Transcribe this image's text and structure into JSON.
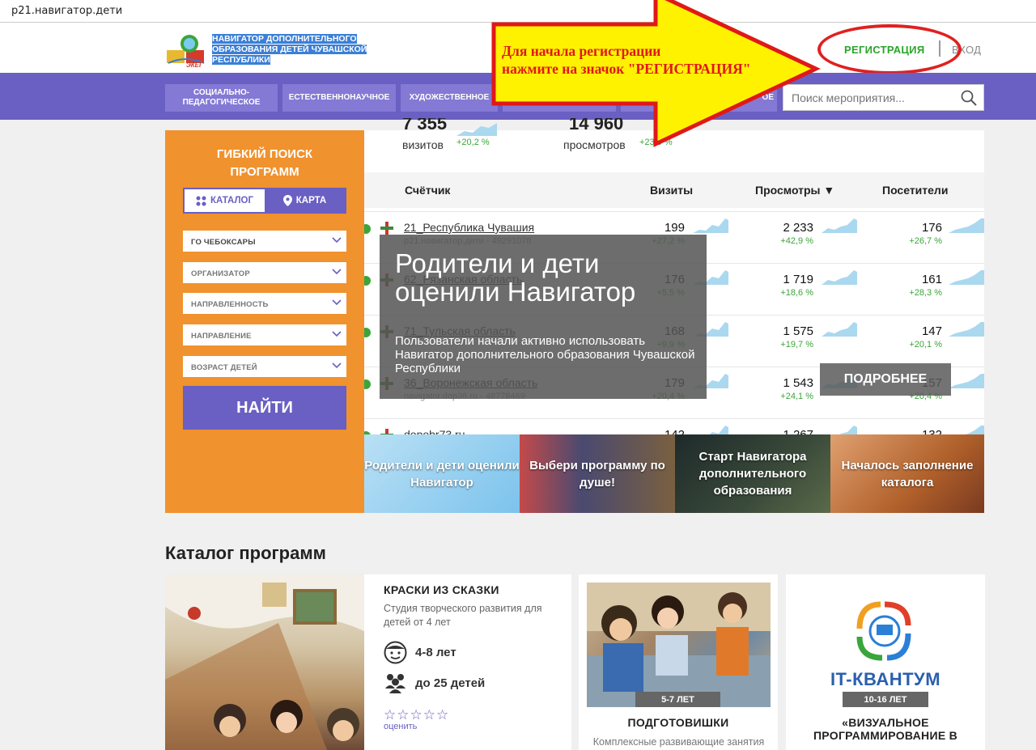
{
  "browser": {
    "url": "p21.навигатор.дети"
  },
  "header": {
    "logo_small": "ЭКЕГ",
    "logo_text": "НАВИГАТОР ДОПОЛНИТЕЛЬНОГО ОБРАЗОВАНИЯ ДЕТЕЙ ЧУВАШСКОЙ РЕСПУБЛИКИ",
    "register": "РЕГИСТРАЦИЯ",
    "login": "ВХОД"
  },
  "annotation": {
    "line1": "Для начала регистрации",
    "line2": "нажмите на значок \"РЕГИСТРАЦИЯ\""
  },
  "nav": {
    "items": [
      "СОЦИАЛЬНО-ПЕДАГОГИЧЕСКОЕ",
      "ЕСТЕСТВЕННОНАУЧНОЕ",
      "ХУДОЖЕСТВЕННОЕ",
      "",
      "",
      "ОЕ"
    ],
    "search_placeholder": "Поиск мероприятия..."
  },
  "filter": {
    "title_line1": "ГИБКИЙ ПОИСК",
    "title_line2": "ПРОГРАММ",
    "tab_catalog": "КАТАЛОГ",
    "tab_map": "КАРТА",
    "selects": [
      "ГО ЧЕБОКСАРЫ",
      "ОРГАНИЗАТОР",
      "НАПРАВЛЕННОСТЬ",
      "НАПРАВЛЕНИЕ",
      "ВОЗРАСТ ДЕТЕЙ"
    ],
    "find": "НАЙТИ"
  },
  "stats": {
    "top": [
      {
        "value": "7 355",
        "label": "визитов",
        "pct": "+20,2 %"
      },
      {
        "value": "14 960",
        "label": "просмотров",
        "pct": "+23,9 %"
      }
    ],
    "headers": {
      "counter": "Счётчик",
      "visits": "Визиты",
      "views": "Просмотры ▼",
      "visitors": "Посетители"
    },
    "rows": [
      {
        "name": "21_Республика Чувашия",
        "sub": "p21.навигатор.дети - 49291078",
        "visits": "199",
        "visits_pct": "+27,2 %",
        "views": "2 233",
        "views_pct": "+42,9 %",
        "visitors": "176",
        "visitors_pct": "+26,7 %"
      },
      {
        "name": "62_Рязанская область",
        "sub": "",
        "visits": "176",
        "visits_pct": "+5,5 %",
        "views": "1 719",
        "views_pct": "+18,6 %",
        "visitors": "161",
        "visitors_pct": "+28,3 %"
      },
      {
        "name": "71_Тульская область",
        "sub": "",
        "visits": "168",
        "visits_pct": "+9,9 %",
        "views": "1 575",
        "views_pct": "+19,7 %",
        "visitors": "147",
        "visitors_pct": "+20,1 %"
      },
      {
        "name": "36_Воронежская область",
        "sub": "navigator.dop36.ru - 48778469",
        "visits": "179",
        "visits_pct": "+20,4 %",
        "views": "1 543",
        "views_pct": "+24,1 %",
        "visitors": "157",
        "visitors_pct": "+20,4 %"
      },
      {
        "name": "dopobr73.ru",
        "sub": "",
        "visits": "142",
        "visits_pct": "",
        "views": "1 267",
        "views_pct": "",
        "visitors": "132",
        "visitors_pct": ""
      }
    ]
  },
  "slide": {
    "title": "Родители и дети оценили Навигатор",
    "text": "Пользователи начали активно использовать Навигатор дополнительного образования Чувашской Республики",
    "more": "ПОДРОБНЕЕ"
  },
  "tiles": [
    {
      "text": "Родители и дети оценили Навигатор",
      "color": "#8fc9ee"
    },
    {
      "text": "Выбери программу по душе!",
      "color": "#5a5a78"
    },
    {
      "text": "Старт Навигатора дополнительного образования",
      "color": "#2d3a3a"
    },
    {
      "text": "Началось заполнение каталога",
      "color": "#a0552a"
    }
  ],
  "catalog": {
    "title": "Каталог программ",
    "card1": {
      "title": "КРАСКИ ИЗ СКАЗКИ",
      "desc": "Студия творческого развития для детей от 4 лет",
      "age": "4-8 лет",
      "group": "до 25 детей",
      "stars": "☆☆☆☆☆",
      "rate": "оценить"
    },
    "card2": {
      "age": "5-7 ЛЕТ",
      "title": "ПОДГОТОВИШКИ",
      "desc": "Комплексные развивающие занятия"
    },
    "card3": {
      "logo": "IT-КВАНТУМ",
      "age": "10-16 ЛЕТ",
      "title_line1": "«ВИЗУАЛЬНОЕ",
      "title_line2": "ПРОГРАММИРОВАНИЕ В"
    }
  }
}
